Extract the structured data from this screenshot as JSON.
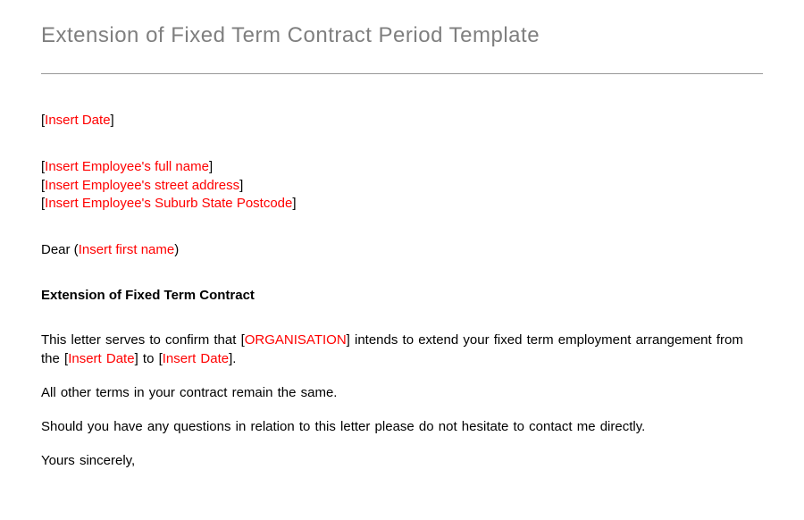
{
  "title": "Extension of Fixed Term Contract Period Template",
  "dateLine": {
    "open": "[",
    "placeholder": "Insert Date",
    "close": "]"
  },
  "address": {
    "line1": {
      "open": "[",
      "placeholder": "Insert Employee's full name",
      "close": "]"
    },
    "line2": {
      "open": "[",
      "placeholder": "Insert Employee's street address",
      "close": "]"
    },
    "line3": {
      "open": "[",
      "placeholder": "Insert Employee's Suburb State Postcode",
      "close": "]"
    }
  },
  "salutation": {
    "prefix": "Dear (",
    "placeholder": "Insert first name",
    "suffix": ")"
  },
  "subject": "Extension  of Fixed Term Contract",
  "para1": {
    "t1": "This letter serves to confirm that [",
    "ph1": "ORGANISATION",
    "t2": "]  intends to extend your fixed term employment arrangement  from the [",
    "ph2": "Insert Date",
    "t3": "] to [",
    "ph3": "Insert Date",
    "t4": "]."
  },
  "para2": "All other terms in your contract remain the same.",
  "para3": "Should you have any questions in relation to this letter please do not hesitate to contact me directly.",
  "closing": "Yours sincerely,"
}
